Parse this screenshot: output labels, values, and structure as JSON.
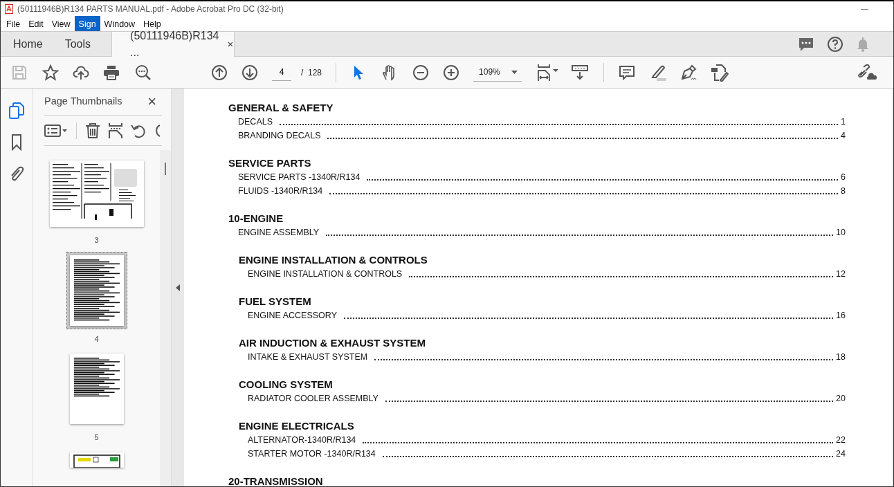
{
  "window": {
    "title": "(50111946B)R134 PARTS MANUAL.pdf - Adobe Acrobat Pro DC (32-bit)",
    "minimize": "—"
  },
  "menu": [
    {
      "label": "File",
      "selected": false
    },
    {
      "label": "Edit",
      "selected": false
    },
    {
      "label": "View",
      "selected": false
    },
    {
      "label": "Sign",
      "selected": true
    },
    {
      "label": "Window",
      "selected": false
    },
    {
      "label": "Help",
      "selected": false
    }
  ],
  "tabs": [
    {
      "label": "Home",
      "selected": false,
      "kind": "nav"
    },
    {
      "label": "Tools",
      "selected": false,
      "kind": "nav"
    },
    {
      "label": "(50111946B)R134 ...",
      "selected": true,
      "kind": "document",
      "close": "×"
    }
  ],
  "toolbar": {
    "page": "4",
    "page_count": "/  128",
    "zoom": "109%"
  },
  "sidebar": {
    "title": "Page Thumbnails",
    "close": "×",
    "thumbnails": [
      {
        "label": "3",
        "selected": false,
        "kind": "landscape"
      },
      {
        "label": "4",
        "selected": true,
        "kind": "toc"
      },
      {
        "label": "5",
        "selected": false,
        "kind": "short"
      },
      {
        "kind": "partial",
        "selected": false
      }
    ]
  },
  "document": {
    "sections": [
      {
        "heading": "GENERAL & SAFETY",
        "entries": [
          {
            "label": "DECALS",
            "page": "1"
          },
          {
            "label": "BRANDING DECALS",
            "page": "4"
          }
        ]
      },
      {
        "heading": "SERVICE PARTS",
        "entries": [
          {
            "label": "SERVICE PARTS -1340R/R134",
            "page": "6"
          },
          {
            "label": "FLUIDS -1340R/R134",
            "page": "8"
          }
        ]
      },
      {
        "heading": "10-ENGINE",
        "entries": [
          {
            "label": "ENGINE ASSEMBLY",
            "page": "10"
          }
        ],
        "children": [
          {
            "heading": "ENGINE INSTALLATION & CONTROLS",
            "entries": [
              {
                "label": "ENGINE INSTALLATION & CONTROLS",
                "page": "12"
              }
            ]
          },
          {
            "heading": "FUEL SYSTEM",
            "entries": [
              {
                "label": "ENGINE ACCESSORY",
                "page": "16"
              }
            ]
          },
          {
            "heading": "AIR INDUCTION & EXHAUST SYSTEM",
            "entries": [
              {
                "label": "INTAKE & EXHAUST SYSTEM",
                "page": "18"
              }
            ]
          },
          {
            "heading": "COOLING SYSTEM",
            "entries": [
              {
                "label": "RADIATOR COOLER ASSEMBLY",
                "page": "20"
              }
            ]
          },
          {
            "heading": "ENGINE ELECTRICALS",
            "entries": [
              {
                "label": "ALTERNATOR-1340R/R134",
                "page": "22"
              },
              {
                "label": "STARTER MOTOR -1340R/R134",
                "page": "24"
              }
            ]
          }
        ]
      },
      {
        "heading": "20-TRANSMISSION"
      }
    ]
  }
}
